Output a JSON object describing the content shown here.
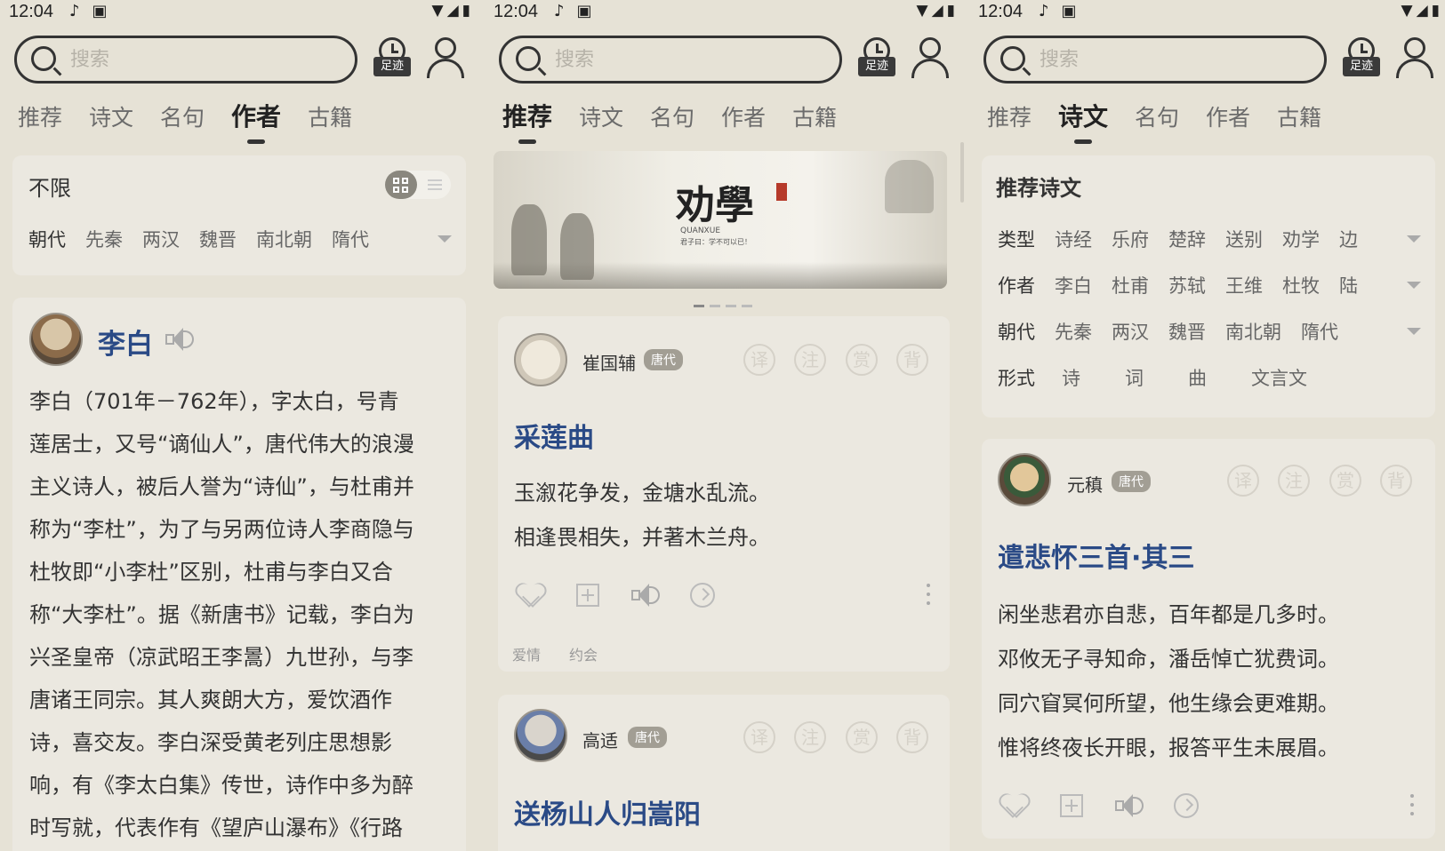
{
  "status_bar": {
    "time": "12:04",
    "notif_icons": [
      "music-icon",
      "a-icon"
    ],
    "sys_icons": [
      "wifi-icon",
      "signal-icon",
      "battery-icon"
    ]
  },
  "search": {
    "placeholder": "搜索"
  },
  "footprint_label": "足迹",
  "tabs": [
    "推荐",
    "诗文",
    "名句",
    "作者",
    "古籍"
  ],
  "panel_author": {
    "active_tab": "作者",
    "filter": {
      "title": "不限",
      "row_label": "朝代",
      "chips": [
        "先秦",
        "两汉",
        "魏晋",
        "南北朝",
        "隋代"
      ]
    },
    "author": {
      "name": "李白",
      "bio_lines": [
        "李白（701年－762年），字太白，号青",
        "莲居士，又号“谪仙人”，唐代伟大的浪漫",
        "主义诗人，被后人誉为“诗仙”，与杜甫并",
        "称为“李杜”，为了与另两位诗人李商隐与",
        "杜牧即“小李杜”区别，杜甫与李白又合",
        "称“大李杜”。据《新唐书》记载，李白为",
        "兴圣皇帝（凉武昭王李暠）九世孙，与李",
        "唐诸王同宗。其人爽朗大方，爱饮酒作",
        "诗，喜交友。李白深受黄老列庄思想影",
        "响，有《李太白集》传世，诗作中多为醉",
        "时写就，代表作有《望庐山瀑布》《行路"
      ]
    }
  },
  "panel_recommend": {
    "active_tab": "推荐",
    "banner": {
      "title": "劝學",
      "subtitle": "QUANXUE",
      "caption": "君子曰：学不可以已！"
    },
    "cards": [
      {
        "poet": "崔国辅",
        "dynasty": "唐代",
        "actions": [
          "译",
          "注",
          "赏",
          "背"
        ],
        "title": "采莲曲",
        "lines": [
          "玉溆花争发，金塘水乱流。",
          "相逢畏相失，并著木兰舟。"
        ],
        "tags": [
          "爱情",
          "约会"
        ]
      },
      {
        "poet": "高适",
        "dynasty": "唐代",
        "actions": [
          "译",
          "注",
          "赏",
          "背"
        ],
        "title": "送杨山人归嵩阳"
      }
    ]
  },
  "panel_poems": {
    "active_tab": "诗文",
    "filter": {
      "title": "推荐诗文",
      "rows": [
        {
          "label": "类型",
          "chips": [
            "诗经",
            "乐府",
            "楚辞",
            "送别",
            "劝学",
            "边"
          ]
        },
        {
          "label": "作者",
          "chips": [
            "李白",
            "杜甫",
            "苏轼",
            "王维",
            "杜牧",
            "陆"
          ]
        },
        {
          "label": "朝代",
          "chips": [
            "先秦",
            "两汉",
            "魏晋",
            "南北朝",
            "隋代"
          ]
        },
        {
          "label": "形式",
          "chips": [
            "诗",
            "词",
            "曲",
            "文言文"
          ]
        }
      ]
    },
    "card": {
      "poet": "元稹",
      "dynasty": "唐代",
      "actions": [
        "译",
        "注",
        "赏",
        "背"
      ],
      "title": "遣悲怀三首·其三",
      "lines": [
        "闲坐悲君亦自悲，百年都是几多时。",
        "邓攸无子寻知命，潘岳悼亡犹费词。",
        "同穴窅冥何所望，他生缘会更难期。",
        "惟将终夜长开眼，报答平生未展眉。"
      ]
    }
  },
  "colors": {
    "background": "#e6e2d6",
    "accent_blue": "#2a4a86",
    "dynasty_badge": "#a29e94"
  }
}
